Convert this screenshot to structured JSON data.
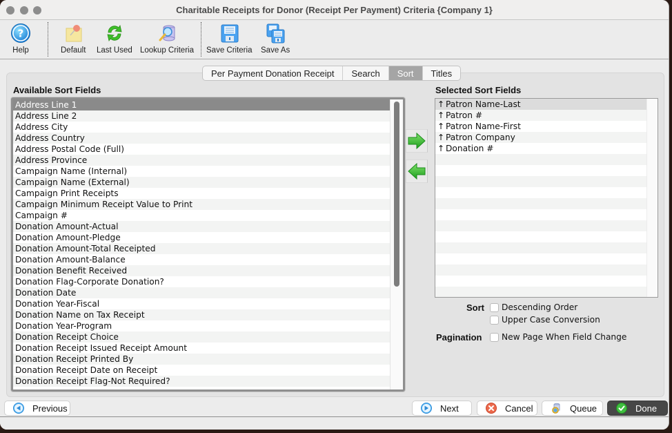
{
  "window": {
    "title": "Charitable Receipts for Donor (Receipt Per Payment) Criteria {Company 1}"
  },
  "toolbar": {
    "buttons": [
      {
        "label": "Help",
        "icon": "help-icon"
      },
      {
        "label": "Default",
        "icon": "pushpin-note-icon"
      },
      {
        "label": "Last Used",
        "icon": "refresh-icon"
      },
      {
        "label": "Lookup Criteria",
        "icon": "database-search-icon"
      },
      {
        "label": "Save Criteria",
        "icon": "floppy-disk-icon"
      },
      {
        "label": "Save As",
        "icon": "floppy-disks-icon"
      }
    ]
  },
  "tabs": [
    {
      "label": "Per Payment Donation Receipt",
      "active": false
    },
    {
      "label": "Search",
      "active": false
    },
    {
      "label": "Sort",
      "active": true
    },
    {
      "label": "Titles",
      "active": false
    }
  ],
  "available": {
    "heading": "Available Sort Fields",
    "selected_index": 0,
    "items": [
      "Address Line 1",
      "Address Line 2",
      "Address City",
      "Address Country",
      "Address Postal Code (Full)",
      "Address Province",
      "Campaign Name (Internal)",
      "Campaign Name (External)",
      "Campaign Print Receipts",
      "Campaign Minimum Receipt Value to Print",
      "Campaign #",
      "Donation Amount-Actual",
      "Donation Amount-Pledge",
      "Donation Amount-Total Receipted",
      "Donation Amount-Balance",
      "Donation Benefit Received",
      "Donation Flag-Corporate Donation?",
      "Donation Date",
      "Donation Year-Fiscal",
      "Donation Name on Tax Receipt",
      "Donation Year-Program",
      "Donation Receipt Choice",
      "Donation Receipt Issued Receipt Amount",
      "Donation Receipt Printed By",
      "Donation Receipt Date on Receipt",
      "Donation Receipt Flag-Not Required?"
    ]
  },
  "transfer": {
    "add_icon": "arrow-right-icon",
    "remove_icon": "arrow-left-icon"
  },
  "selected": {
    "heading": "Selected Sort Fields",
    "selected_index": 0,
    "direction_glyph": "↑",
    "items": [
      "Patron Name-Last",
      "Patron #",
      "Patron Name-First",
      "Patron Company",
      "Donation #"
    ]
  },
  "options": {
    "sort_label": "Sort",
    "pagination_label": "Pagination",
    "descending": {
      "label": "Descending Order",
      "checked": false
    },
    "upper_case": {
      "label": "Upper Case Conversion",
      "checked": false
    },
    "new_page": {
      "label": "New Page When Field Change",
      "checked": false
    }
  },
  "footer": {
    "previous": "Previous",
    "next": "Next",
    "cancel": "Cancel",
    "queue": "Queue",
    "done": "Done"
  },
  "colors": {
    "list_selection": "#8a8a8a",
    "active_tab": "#a5a5a5",
    "done_button": "#474747",
    "arrow_green": "#3cc23c"
  }
}
